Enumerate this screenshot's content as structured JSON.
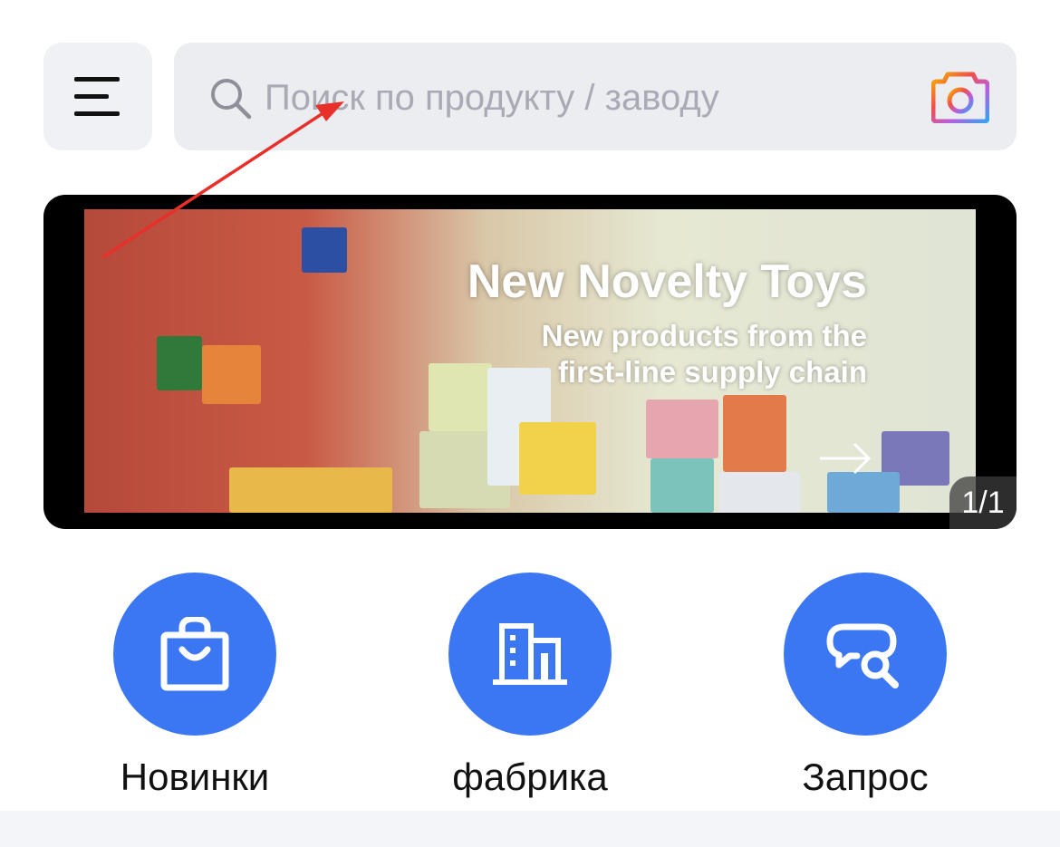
{
  "header": {
    "menu_icon": "hamburger-menu-icon",
    "search": {
      "placeholder": "Поиск по продукту / заводу",
      "value": "",
      "icon": "search-icon",
      "camera_icon": "camera-icon"
    }
  },
  "banner": {
    "title": "New Novelty Toys",
    "subtitle": "New products from the first-line supply chain",
    "pager": "1/1"
  },
  "actions": [
    {
      "label": "Новинки",
      "icon": "shopping-bag-icon"
    },
    {
      "label": "фабрика",
      "icon": "factory-building-icon"
    },
    {
      "label": "Запрос",
      "icon": "chat-search-icon"
    }
  ],
  "colors": {
    "accent": "#3b77f2",
    "search_bg": "#ecedf1",
    "menu_bg": "#f0f1f5",
    "annotation": "#e8302a"
  }
}
